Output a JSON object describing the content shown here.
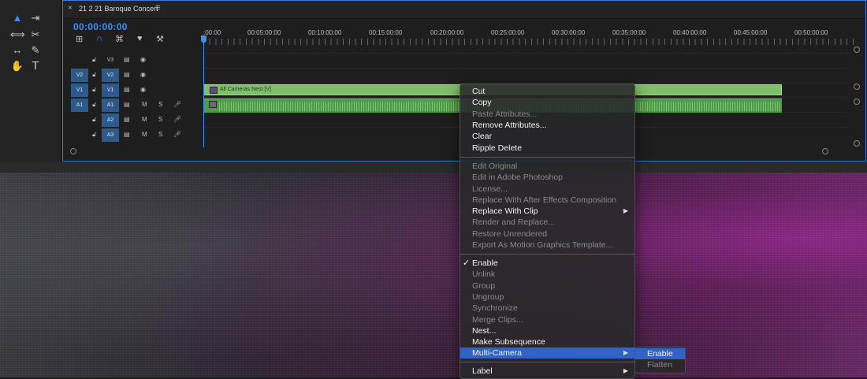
{
  "timeline": {
    "close": "×",
    "title": "21 2 21 Baroque Concert",
    "menu_icon": "≡",
    "timecode": "00:00:00:00",
    "ruler_labels": [
      ":00:00",
      "00:05:00:00",
      "00:10:00:00",
      "00:15:00:00",
      "00:20:00:00",
      "00:25:00:00",
      "00:30:00:00",
      "00:35:00:00",
      "00:40:00:00",
      "00:45:00:00",
      "00:50:00:00"
    ],
    "tracks": [
      {
        "patch": "",
        "name": "V3",
        "m": "",
        "s": ""
      },
      {
        "patch": "V2",
        "name": "V2",
        "m": "",
        "s": ""
      },
      {
        "patch": "V1",
        "name": "V1",
        "m": "",
        "s": ""
      },
      {
        "patch": "A1",
        "name": "A1",
        "m": "M",
        "s": "S"
      },
      {
        "patch": "",
        "name": "A2",
        "m": "M",
        "s": "S"
      },
      {
        "patch": "",
        "name": "A3",
        "m": "M",
        "s": "S"
      }
    ],
    "video_clip_label": "All Cameras Nest [V]"
  },
  "context_menu": {
    "items": [
      {
        "label": "Cut",
        "disabled": false
      },
      {
        "label": "Copy",
        "disabled": false
      },
      {
        "label": "Paste Attributes...",
        "disabled": true
      },
      {
        "label": "Remove Attributes...",
        "disabled": false
      },
      {
        "label": "Clear",
        "disabled": false
      },
      {
        "label": "Ripple Delete",
        "disabled": false
      },
      {
        "label": "Edit Original",
        "disabled": true
      },
      {
        "label": "Edit in Adobe Photoshop",
        "disabled": true
      },
      {
        "label": "License...",
        "disabled": true
      },
      {
        "label": "Replace With After Effects Composition",
        "disabled": true
      },
      {
        "label": "Replace With Clip",
        "disabled": false,
        "submenu": true
      },
      {
        "label": "Render and Replace...",
        "disabled": true
      },
      {
        "label": "Restore Unrendered",
        "disabled": true
      },
      {
        "label": "Export As Motion Graphics Template...",
        "disabled": true
      },
      {
        "label": "Enable",
        "disabled": false,
        "checked": true
      },
      {
        "label": "Unlink",
        "disabled": true
      },
      {
        "label": "Group",
        "disabled": true
      },
      {
        "label": "Ungroup",
        "disabled": true
      },
      {
        "label": "Synchronize",
        "disabled": true
      },
      {
        "label": "Merge Clips...",
        "disabled": true
      },
      {
        "label": "Nest...",
        "disabled": false
      },
      {
        "label": "Make Subsequence",
        "disabled": false
      },
      {
        "label": "Multi-Camera",
        "disabled": false,
        "submenu": true,
        "highlighted": true
      },
      {
        "label": "Label",
        "disabled": false,
        "submenu": true
      }
    ],
    "check_mark": "✓",
    "submenu_arrow": "▶"
  },
  "multicam_submenu": {
    "items": [
      {
        "label": "Enable",
        "disabled": false,
        "highlighted": true
      },
      {
        "label": "Flatten",
        "disabled": true
      }
    ]
  },
  "colors": {
    "accent": "#3b8ff5",
    "highlight": "#2f63c6",
    "clip_green": "#7fbf6b"
  }
}
